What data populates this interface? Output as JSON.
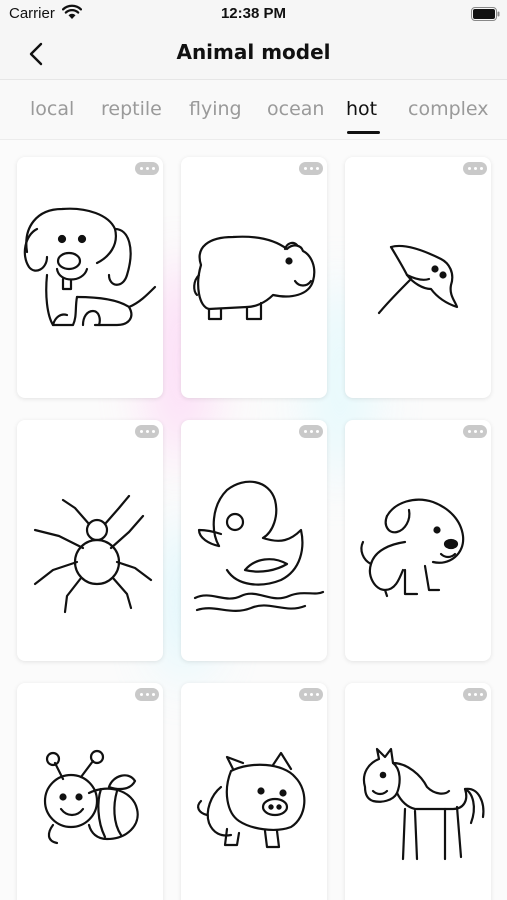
{
  "status_bar": {
    "carrier": "Carrier",
    "time": "12:38 PM"
  },
  "nav": {
    "title": "Animal model"
  },
  "tabs": [
    {
      "label": "local",
      "active": false
    },
    {
      "label": "reptile",
      "active": false
    },
    {
      "label": "flying",
      "active": false
    },
    {
      "label": "ocean",
      "active": false
    },
    {
      "label": "hot",
      "active": true
    },
    {
      "label": "complex",
      "active": false
    }
  ],
  "cards": [
    {
      "icon": "puppy-drawing-icon"
    },
    {
      "icon": "hippo-drawing-icon"
    },
    {
      "icon": "stingray-drawing-icon"
    },
    {
      "icon": "spider-drawing-icon"
    },
    {
      "icon": "duck-drawing-icon"
    },
    {
      "icon": "dog-drawing-icon"
    },
    {
      "icon": "bee-drawing-icon"
    },
    {
      "icon": "pig-drawing-icon"
    },
    {
      "icon": "horse-drawing-icon"
    }
  ]
}
